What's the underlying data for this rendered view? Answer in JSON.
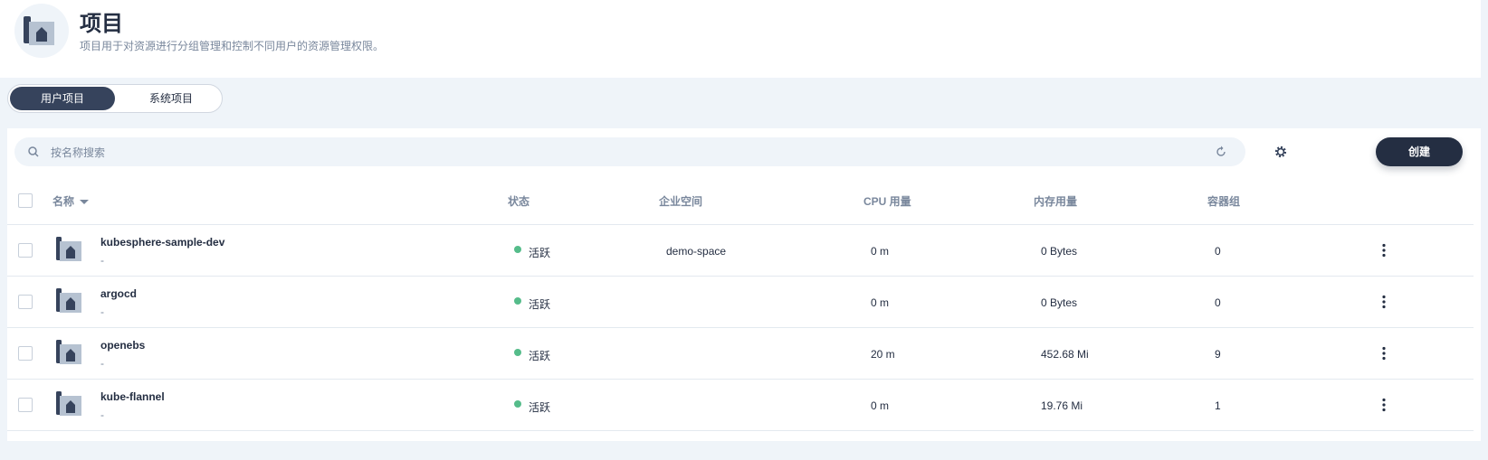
{
  "header": {
    "title": "项目",
    "description": "项目用于对资源进行分组管理和控制不同用户的资源管理权限。",
    "icon": "project-icon"
  },
  "tabs": [
    {
      "label": "用户项目",
      "active": true
    },
    {
      "label": "系统项目",
      "active": false
    }
  ],
  "toolbar": {
    "search_placeholder": "按名称搜索",
    "refresh_icon": "refresh-icon",
    "settings_icon": "gear-icon",
    "create_label": "创建"
  },
  "table": {
    "columns": [
      "名称",
      "状态",
      "企业空间",
      "CPU 用量",
      "内存用量",
      "容器组"
    ],
    "rows": [
      {
        "name": "kubesphere-sample-dev",
        "desc": "-",
        "status": "活跃",
        "workspace": "demo-space",
        "cpu": "0 m",
        "memory": "0 Bytes",
        "pods": "0"
      },
      {
        "name": "argocd",
        "desc": "-",
        "status": "活跃",
        "workspace": "",
        "cpu": "0 m",
        "memory": "0 Bytes",
        "pods": "0"
      },
      {
        "name": "openebs",
        "desc": "-",
        "status": "活跃",
        "workspace": "",
        "cpu": "20 m",
        "memory": "452.68 Mi",
        "pods": "9"
      },
      {
        "name": "kube-flannel",
        "desc": "-",
        "status": "活跃",
        "workspace": "",
        "cpu": "0 m",
        "memory": "19.76 Mi",
        "pods": "1"
      }
    ]
  },
  "colors": {
    "primary": "#242e42",
    "status_active": "#55bc8a",
    "muted_text": "#79879c",
    "background": "#eff4f9"
  }
}
